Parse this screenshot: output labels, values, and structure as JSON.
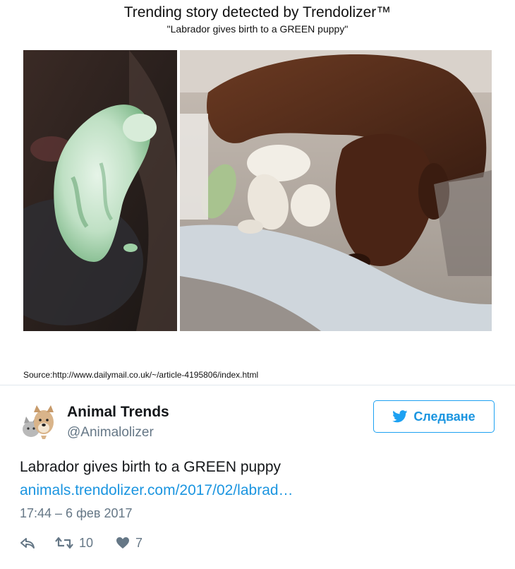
{
  "card": {
    "title": "Trending story detected by Trendolizer™",
    "subtitle": "\"Labrador gives birth to a GREEN puppy\"",
    "source": "Source:http://www.dailymail.co.uk/~/article-4195806/index.html"
  },
  "tweet": {
    "author_name": "Animal Trends",
    "author_handle": "@Animalolizer",
    "follow_label": "Следване",
    "text": "Labrador gives birth to a GREEN puppy",
    "link": "animals.trendolizer.com/2017/02/labrad…",
    "timestamp": "17:44 – 6 фев 2017",
    "retweet_count": "10",
    "like_count": "7"
  },
  "icons": {
    "follow": "bird-icon",
    "reply": "reply-icon",
    "retweet": "retweet-icon",
    "like": "heart-icon"
  },
  "colors": {
    "accent": "#1b95e0",
    "muted": "#657786",
    "text": "#14171a",
    "divider": "#e1e8ed"
  }
}
